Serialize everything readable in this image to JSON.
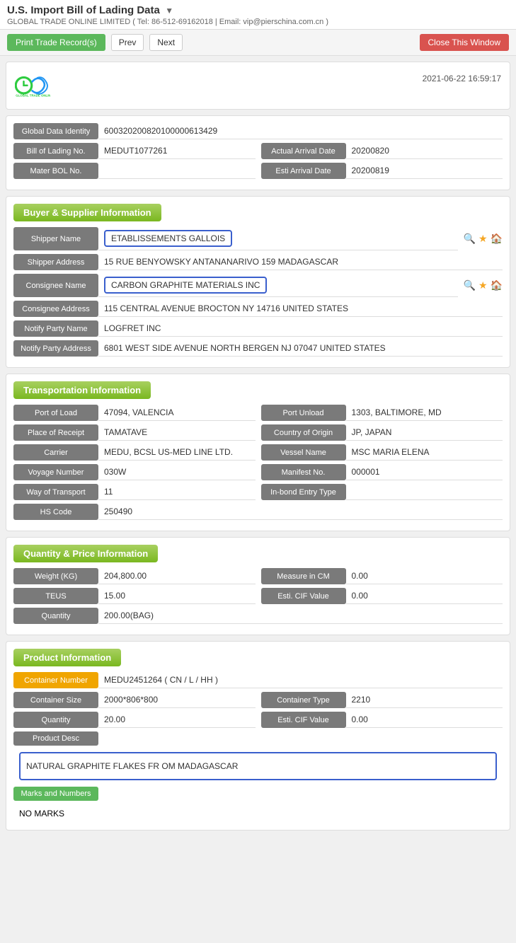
{
  "header": {
    "title": "U.S. Import Bill of Lading Data",
    "subtitle": "GLOBAL TRADE ONLINE LIMITED ( Tel: 86-512-69162018 | Email: vip@pierschina.com.cn )",
    "datetime": "2021-06-22 16:59:17"
  },
  "toolbar": {
    "print_label": "Print Trade Record(s)",
    "prev_label": "Prev",
    "next_label": "Next",
    "close_label": "Close This Window"
  },
  "identity": {
    "global_data_label": "Global Data Identity",
    "global_data_value": "600320200820100000613429",
    "bol_label": "Bill of Lading No.",
    "bol_value": "MEDUT1077261",
    "arrival_label": "Actual Arrival Date",
    "arrival_value": "20200820",
    "master_label": "Mater BOL No.",
    "master_value": "",
    "esti_label": "Esti Arrival Date",
    "esti_value": "20200819"
  },
  "buyer_supplier": {
    "section_title": "Buyer & Supplier Information",
    "shipper_name_label": "Shipper Name",
    "shipper_name_value": "ETABLISSEMENTS GALLOIS",
    "shipper_addr_label": "Shipper Address",
    "shipper_addr_value": "15 RUE BENYOWSKY ANTANANARIVO 159 MADAGASCAR",
    "consignee_name_label": "Consignee Name",
    "consignee_name_value": "CARBON GRAPHITE MATERIALS INC",
    "consignee_addr_label": "Consignee Address",
    "consignee_addr_value": "115 CENTRAL AVENUE BROCTON NY 14716 UNITED STATES",
    "notify_name_label": "Notify Party Name",
    "notify_name_value": "LOGFRET INC",
    "notify_addr_label": "Notify Party Address",
    "notify_addr_value": "6801 WEST SIDE AVENUE NORTH BERGEN NJ 07047 UNITED STATES"
  },
  "transportation": {
    "section_title": "Transportation Information",
    "port_load_label": "Port of Load",
    "port_load_value": "47094, VALENCIA",
    "port_unload_label": "Port Unload",
    "port_unload_value": "1303, BALTIMORE, MD",
    "place_receipt_label": "Place of Receipt",
    "place_receipt_value": "TAMATAVE",
    "country_origin_label": "Country of Origin",
    "country_origin_value": "JP, JAPAN",
    "carrier_label": "Carrier",
    "carrier_value": "MEDU, BCSL US-MED LINE LTD.",
    "vessel_label": "Vessel Name",
    "vessel_value": "MSC MARIA ELENA",
    "voyage_label": "Voyage Number",
    "voyage_value": "030W",
    "manifest_label": "Manifest No.",
    "manifest_value": "000001",
    "way_label": "Way of Transport",
    "way_value": "11",
    "inbond_label": "In-bond Entry Type",
    "inbond_value": "",
    "hs_label": "HS Code",
    "hs_value": "250490"
  },
  "quantity": {
    "section_title": "Quantity & Price Information",
    "weight_label": "Weight (KG)",
    "weight_value": "204,800.00",
    "measure_label": "Measure in CM",
    "measure_value": "0.00",
    "teus_label": "TEUS",
    "teus_value": "15.00",
    "cif_label": "Esti. CIF Value",
    "cif_value": "0.00",
    "qty_label": "Quantity",
    "qty_value": "200.00(BAG)"
  },
  "product": {
    "section_title": "Product Information",
    "container_num_label": "Container Number",
    "container_num_value": "MEDU2451264 ( CN / L / HH )",
    "container_size_label": "Container Size",
    "container_size_value": "2000*806*800",
    "container_type_label": "Container Type",
    "container_type_value": "2210",
    "qty_label": "Quantity",
    "qty_value": "20.00",
    "cif_label": "Esti. CIF Value",
    "cif_value": "0.00",
    "desc_label": "Product Desc",
    "desc_value": "NATURAL GRAPHITE FLAKES FR OM MADAGASCAR",
    "marks_label": "Marks and Numbers",
    "marks_value": "NO MARKS"
  }
}
